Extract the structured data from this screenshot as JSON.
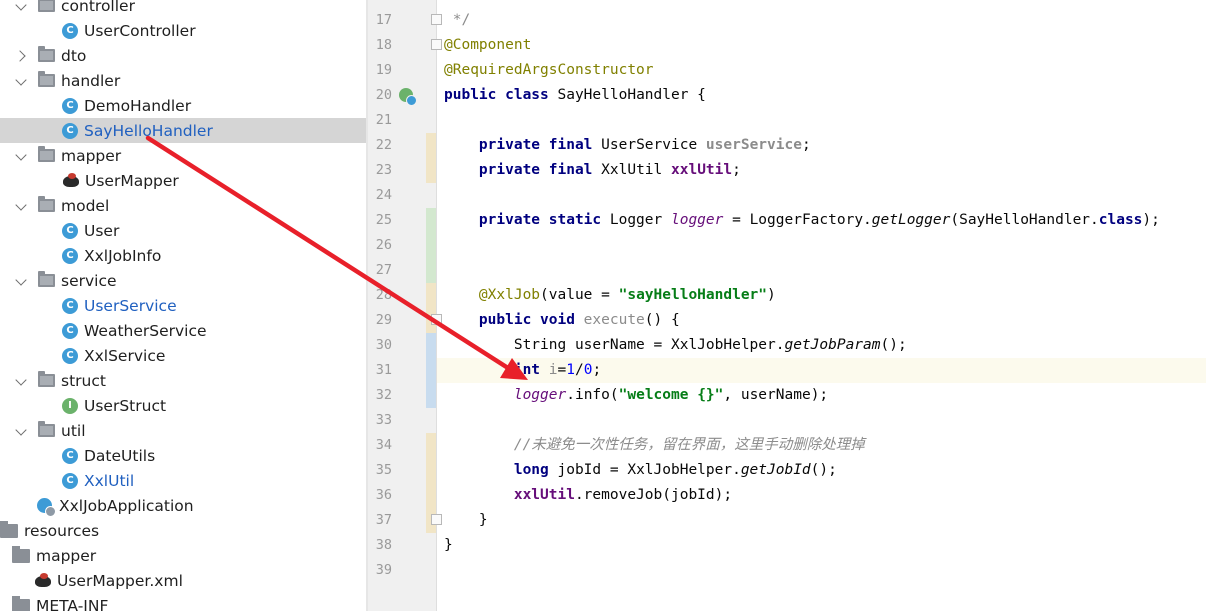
{
  "project_tree": {
    "items": [
      {
        "label": "controller",
        "kind": "folder",
        "state": "open"
      },
      {
        "label": "UserController",
        "kind": "class"
      },
      {
        "label": "dto",
        "kind": "folder",
        "state": "closed"
      },
      {
        "label": "handler",
        "kind": "folder",
        "state": "open"
      },
      {
        "label": "DemoHandler",
        "kind": "class"
      },
      {
        "label": "SayHelloHandler",
        "kind": "class",
        "selected": true
      },
      {
        "label": "mapper",
        "kind": "folder",
        "state": "open"
      },
      {
        "label": "UserMapper",
        "kind": "mybatis"
      },
      {
        "label": "model",
        "kind": "folder",
        "state": "open"
      },
      {
        "label": "User",
        "kind": "class"
      },
      {
        "label": "XxlJobInfo",
        "kind": "class"
      },
      {
        "label": "service",
        "kind": "folder",
        "state": "open"
      },
      {
        "label": "UserService",
        "kind": "class",
        "modified": true
      },
      {
        "label": "WeatherService",
        "kind": "class"
      },
      {
        "label": "XxlService",
        "kind": "class"
      },
      {
        "label": "struct",
        "kind": "folder",
        "state": "open"
      },
      {
        "label": "UserStruct",
        "kind": "interface"
      },
      {
        "label": "util",
        "kind": "folder",
        "state": "open"
      },
      {
        "label": "DateUtils",
        "kind": "class"
      },
      {
        "label": "XxlUtil",
        "kind": "class",
        "modified": true
      },
      {
        "label": "XxlJobApplication",
        "kind": "application"
      },
      {
        "label": "resources",
        "kind": "folder-plain"
      },
      {
        "label": "mapper",
        "kind": "folder-plain"
      },
      {
        "label": "UserMapper.xml",
        "kind": "mybatis"
      },
      {
        "label": "META-INF",
        "kind": "folder-plain"
      }
    ],
    "icon_letters": {
      "class": "C",
      "interface": "I"
    }
  },
  "editor": {
    "line_numbers": [
      "17",
      "18",
      "19",
      "20",
      "21",
      "22",
      "23",
      "24",
      "25",
      "26",
      "27",
      "28",
      "29",
      "30",
      "31",
      "32",
      "33",
      "34",
      "35",
      "36",
      "37",
      "38",
      "39"
    ],
    "code": {
      "l17": " */",
      "l18_ann": "@Component",
      "l19_ann": "@RequiredArgsConstructor",
      "l20_kw": "public class",
      "l20_rest": " SayHelloHandler {",
      "l22_kw": "private final",
      "l22_type": " UserService ",
      "l22_field": "userService",
      "l22_end": ";",
      "l23_kw": "private final",
      "l23_type": " XxlUtil ",
      "l23_field": "xxlUtil",
      "l23_end": ";",
      "l25_kw": "private static",
      "l25_type": " Logger ",
      "l25_field": "logger",
      "l25_mid": " = LoggerFactory.",
      "l25_method": "getLogger",
      "l25_arg": "(SayHelloHandler.",
      "l25_cls": "class",
      "l25_end": ");",
      "l28_ann": "@XxlJob",
      "l28_mid": "(value = ",
      "l28_str": "\"sayHelloHandler\"",
      "l28_end": ")",
      "l29_kw": "public void",
      "l29_name": " execute",
      "l29_end": "() {",
      "l30_a": "String userName = XxlJobHelper.",
      "l30_method": "getJobParam",
      "l30_end": "();",
      "l31_kw": "int",
      "l31_var": " i",
      "l31_eq": "=",
      "l31_n1": "1",
      "l31_slash": "/",
      "l31_n2": "0",
      "l31_end": ";",
      "l32_field": "logger",
      "l32_mid": ".info(",
      "l32_str": "\"welcome {}\"",
      "l32_end": ", userName);",
      "l34_cmt": "//未避免一次性任务，留在界面，这里手动删除处理掉",
      "l35_kw": "long",
      "l35_mid": " jobId = XxlJobHelper.",
      "l35_method": "getJobId",
      "l35_end": "();",
      "l36_field": "xxlUtil",
      "l36_end": ".removeJob(jobId);",
      "l37": "}",
      "l38": "}"
    }
  },
  "colors": {
    "keyword": "#00007f",
    "annotation": "#808000",
    "field": "#660e7a",
    "string": "#067d17",
    "number": "#0000ff",
    "comment": "#8c8c8c",
    "selection": "#d5d5d5",
    "current_line": "#fcfaed",
    "arrow": "#e8202a"
  }
}
